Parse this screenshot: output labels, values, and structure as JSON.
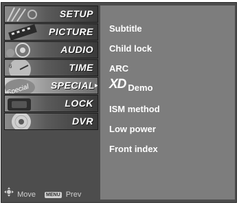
{
  "sidebar": {
    "items": [
      {
        "label": "SETUP",
        "icon": "setup-icon"
      },
      {
        "label": "PICTURE",
        "icon": "picture-icon"
      },
      {
        "label": "AUDIO",
        "icon": "audio-icon"
      },
      {
        "label": "TIME",
        "icon": "time-icon"
      },
      {
        "label": "SPECIAL",
        "icon": "special-icon",
        "selected": true
      },
      {
        "label": "LOCK",
        "icon": "lock-icon"
      },
      {
        "label": "DVR",
        "icon": "dvr-icon"
      }
    ],
    "footer": {
      "move_label": "Move",
      "menu_key_label": "MENU",
      "prev_label": "Prev"
    }
  },
  "submenu": {
    "items": [
      {
        "label": "Subtitle"
      },
      {
        "label": "Child lock"
      },
      {
        "label": "ARC"
      },
      {
        "label": "XD",
        "suffix": "Demo"
      },
      {
        "label": "ISM method"
      },
      {
        "label": "Low power"
      },
      {
        "label": "Front index"
      }
    ]
  },
  "colors": {
    "panel_bg": "#4d4d4d",
    "submenu_bg": "#7d7d7d",
    "text": "#ffffff"
  }
}
